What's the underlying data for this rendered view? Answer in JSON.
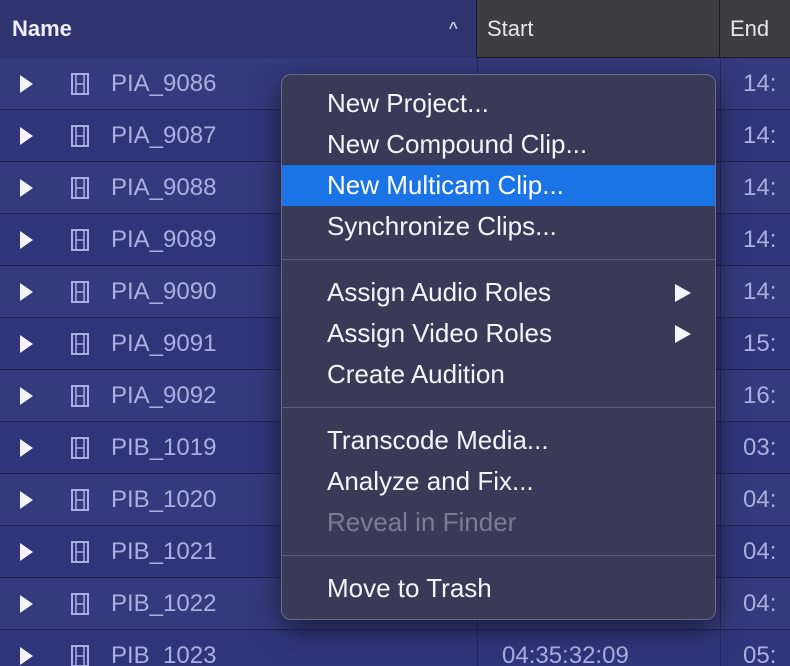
{
  "header": {
    "name_label": "Name",
    "start_label": "Start",
    "end_label": "End",
    "sort_icon": "chevron-up-icon"
  },
  "rows": [
    {
      "name": "PIA_9086",
      "start": "",
      "end": "14:"
    },
    {
      "name": "PIA_9087",
      "start": "",
      "end": "14:"
    },
    {
      "name": "PIA_9088",
      "start": "",
      "end": "14:"
    },
    {
      "name": "PIA_9089",
      "start": "",
      "end": "14:"
    },
    {
      "name": "PIA_9090",
      "start": "",
      "end": "14:"
    },
    {
      "name": "PIA_9091",
      "start": "",
      "end": "15:"
    },
    {
      "name": "PIA_9092",
      "start": "",
      "end": "16:"
    },
    {
      "name": "PIB_1019",
      "start": "",
      "end": "03:"
    },
    {
      "name": "PIB_1020",
      "start": "",
      "end": "04:"
    },
    {
      "name": "PIB_1021",
      "start": "",
      "end": "04:"
    },
    {
      "name": "PIB_1022",
      "start": "",
      "end": "04:"
    },
    {
      "name": "PIB_1023",
      "start": "04:35:32:09",
      "end": "05:"
    }
  ],
  "context_menu": {
    "group1": [
      {
        "label": "New Project...",
        "state": "normal"
      },
      {
        "label": "New Compound Clip...",
        "state": "normal"
      },
      {
        "label": "New Multicam Clip...",
        "state": "highlighted"
      },
      {
        "label": "Synchronize Clips...",
        "state": "normal"
      }
    ],
    "group2": [
      {
        "label": "Assign Audio Roles",
        "state": "normal",
        "submenu": true
      },
      {
        "label": "Assign Video Roles",
        "state": "normal",
        "submenu": true
      },
      {
        "label": "Create Audition",
        "state": "normal"
      }
    ],
    "group3": [
      {
        "label": "Transcode Media...",
        "state": "normal"
      },
      {
        "label": "Analyze and Fix...",
        "state": "normal"
      },
      {
        "label": "Reveal in Finder",
        "state": "disabled"
      }
    ],
    "group4": [
      {
        "label": "Move to Trash",
        "state": "normal"
      }
    ]
  },
  "colors": {
    "highlight": "#1a74e6",
    "row_bg": "#353a7d",
    "menu_bg": "#383a57"
  }
}
